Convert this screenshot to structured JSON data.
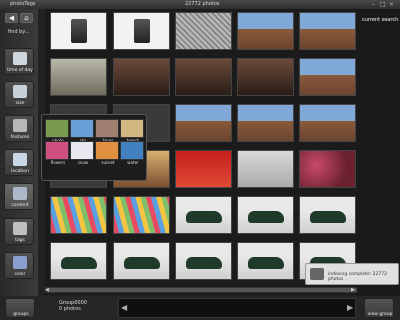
{
  "titlebar": {
    "brand": "photoTags",
    "count": "22772 photos",
    "buttons": [
      "–",
      "□",
      "×"
    ]
  },
  "sidebar": {
    "back_label": "◀",
    "home_label": "⌂",
    "findby_label": "find by...",
    "buttons": [
      {
        "label": "time of day",
        "icon": "clock-icon",
        "color": "#cfd8e0"
      },
      {
        "label": "size",
        "icon": "monitor-icon",
        "color": "#c8d0d8"
      },
      {
        "label": "features",
        "icon": "gear-icon",
        "color": "#b8b8b8"
      },
      {
        "label": "location",
        "icon": "house-icon",
        "color": "#c8d8e8"
      },
      {
        "label": "content",
        "icon": "content-icon",
        "color": "#aab8c8"
      },
      {
        "label": "tags",
        "icon": "tag-icon",
        "color": "#c0c0c0"
      },
      {
        "label": "color",
        "icon": "palette-icon",
        "color": "#8aa0d0"
      }
    ]
  },
  "right_panel": {
    "label": "current search"
  },
  "content_popup": {
    "items": [
      {
        "label": "photo",
        "color": "#7a9a50"
      },
      {
        "label": "sky",
        "color": "#6aa0d8"
      },
      {
        "label": "faces",
        "color": "#a08070"
      },
      {
        "label": "beach",
        "color": "#d0b880"
      },
      {
        "label": "flowers",
        "color": "#d05080"
      },
      {
        "label": "snow",
        "color": "#e8e8f0"
      },
      {
        "label": "sunset",
        "color": "#e09040"
      },
      {
        "label": "water",
        "color": "#4080c0"
      }
    ]
  },
  "grid": {
    "rows": [
      [
        "cam",
        "cam",
        "pattern",
        "city",
        "city"
      ],
      [
        "gothic",
        "people",
        "people",
        "people",
        "city"
      ],
      [
        "dark",
        "dark",
        "city",
        "city",
        "city"
      ],
      [
        "dark",
        "warm",
        "red",
        "sign",
        "flower"
      ],
      [
        "pencil",
        "pencil",
        "car",
        "car",
        "car"
      ],
      [
        "car",
        "car",
        "car",
        "car",
        "car"
      ]
    ]
  },
  "bottom": {
    "groups_label": "groups",
    "group_name": "Group0000",
    "group_count": "0 photos",
    "view_group_label": "view group",
    "prev_label": "◀",
    "next_label": "▶"
  },
  "toast": {
    "text": "indexing complete: 22772 photos"
  },
  "scrollbar": {
    "left": "◀",
    "right": "▶"
  }
}
